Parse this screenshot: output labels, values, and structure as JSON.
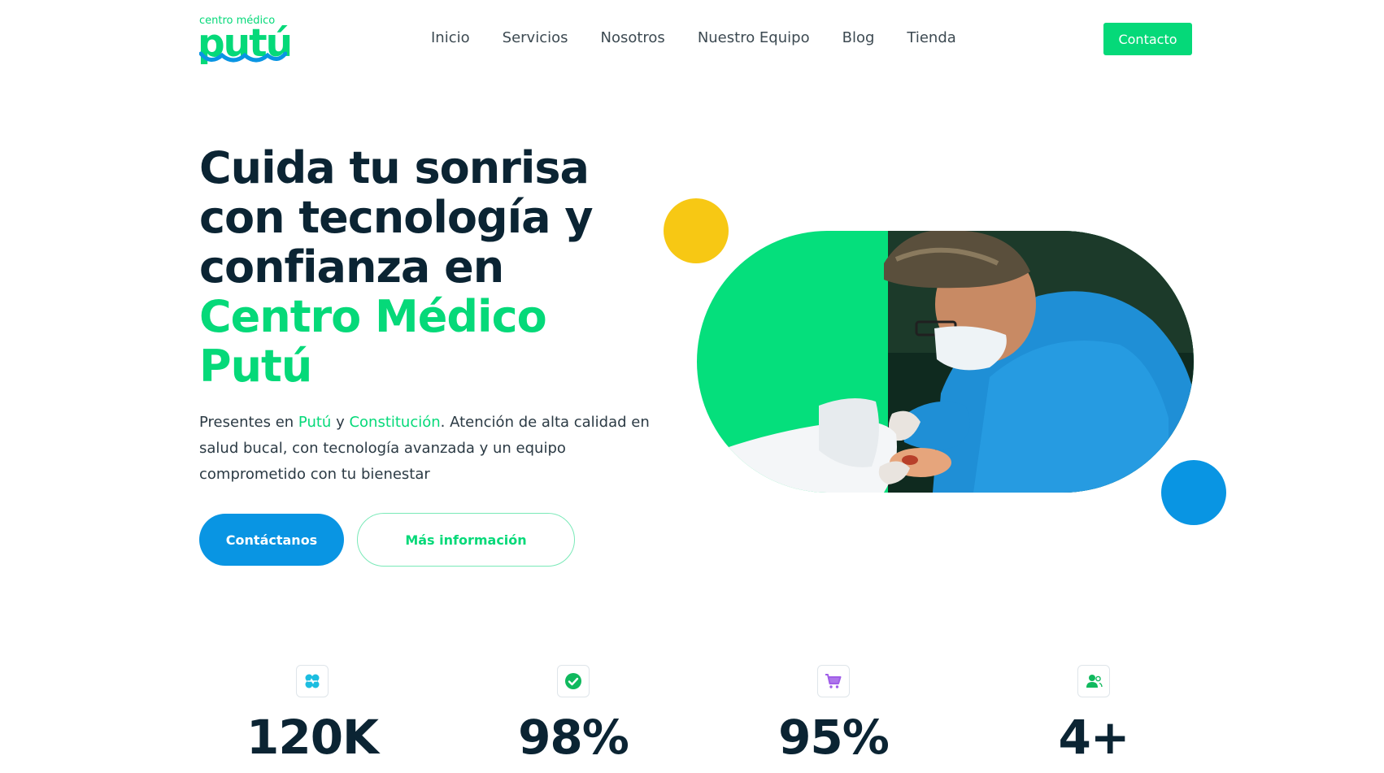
{
  "brand": {
    "small": "centro médico",
    "name": "putú",
    "color": "#05d979",
    "wave_color": "#0995e3"
  },
  "nav": {
    "items": [
      "Inicio",
      "Servicios",
      "Nosotros",
      "Nuestro Equipo",
      "Blog",
      "Tienda"
    ]
  },
  "header": {
    "contact_label": "Contacto"
  },
  "hero": {
    "title_part1": "Cuida tu sonrisa con tecnología y confianza en ",
    "title_accent": "Centro Médico Putú",
    "desc_prefix": "Presentes en ",
    "desc_loc1": "Putú",
    "desc_and": " y ",
    "desc_loc2": "Constitución",
    "desc_suffix": ". Atención de alta calidad en salud bucal, con tecnología avanzada y un equipo comprometido con tu bienestar",
    "primary_cta": "Contáctanos",
    "secondary_cta": "Más información",
    "image_icon": "dentist-photo"
  },
  "stats": [
    {
      "icon": "tooth-heart-icon",
      "value": "120K"
    },
    {
      "icon": "check-circle-icon",
      "value": "98%"
    },
    {
      "icon": "cart-icon",
      "value": "95%"
    },
    {
      "icon": "user-icon",
      "value": "4+"
    }
  ],
  "colors": {
    "green": "#05d979",
    "blue": "#0995e3",
    "yellow": "#f7c814",
    "dark": "#0b2433"
  }
}
